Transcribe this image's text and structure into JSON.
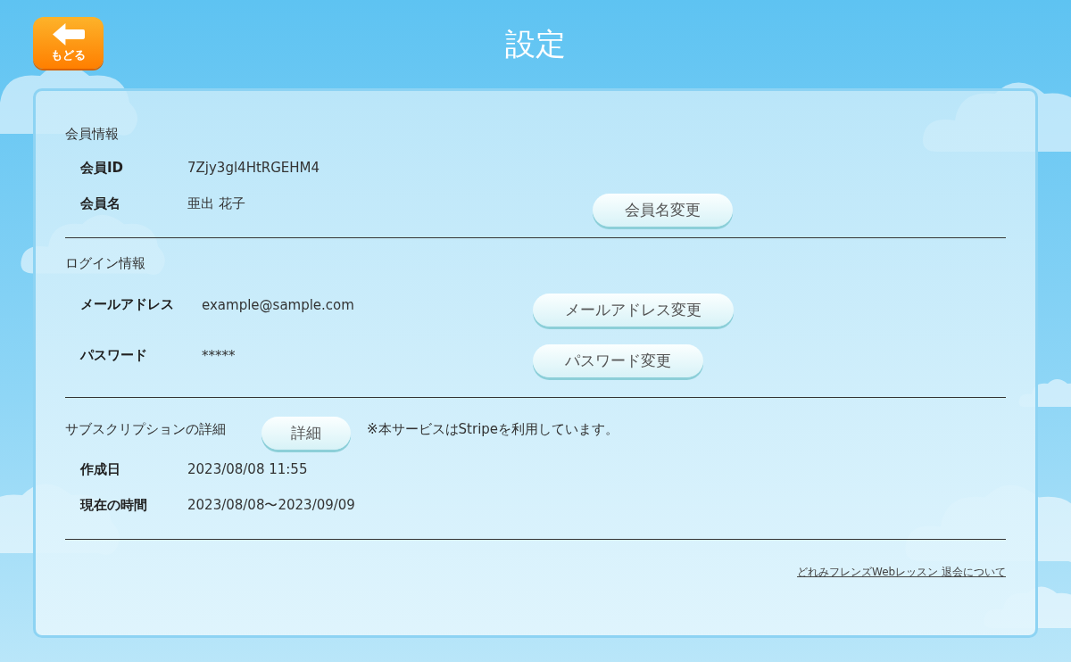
{
  "header": {
    "back_button": "もどる",
    "title": "設定"
  },
  "sections": [
    {
      "heading": "会員情報",
      "rows": [
        {
          "label": "会員ID",
          "value": "7Zjy3gl4HtRGEHM4"
        },
        {
          "label": "会員名",
          "value": "亜出 花子",
          "button": "会員名変更"
        }
      ]
    },
    {
      "heading": "ログイン情報",
      "rows": [
        {
          "label": "メールアドレス",
          "value": "example@sample.com",
          "button": "メールアドレス変更"
        },
        {
          "label": "パスワード",
          "value": "*****",
          "button": "パスワード変更"
        }
      ]
    },
    {
      "heading": "サブスクリプションの詳細",
      "heading_button": "詳細",
      "note": "※本サービスはStripeを利用しています。",
      "rows": [
        {
          "label": "作成日",
          "value": "2023/08/08 11:55"
        },
        {
          "label": "現在の時間",
          "value": "2023/08/08〜2023/09/09"
        }
      ]
    }
  ],
  "footer_link": "どれみフレンズWebレッスン 退会について"
}
